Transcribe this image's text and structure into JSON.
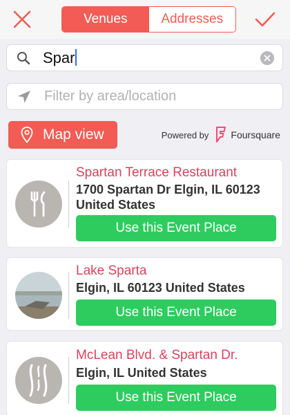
{
  "header": {
    "close_icon": "close-icon",
    "confirm_icon": "checkmark-icon",
    "tabs": [
      {
        "label": "Venues",
        "active": true
      },
      {
        "label": "Addresses",
        "active": false
      }
    ]
  },
  "search": {
    "value": "Spar",
    "icon": "search-icon",
    "clear_icon": "clear-icon"
  },
  "filter": {
    "placeholder": "Filter by area/location",
    "icon": "location-arrow-icon"
  },
  "map_view": {
    "label": "Map view",
    "icon": "map-pin-icon"
  },
  "powered_by": {
    "label": "Powered by",
    "brand": "Foursquare"
  },
  "results": [
    {
      "name": "Spartan Terrace Restaurant",
      "address": "1700 Spartan Dr Elgin, IL 60123 United States",
      "thumbnail": "fork-knife-icon",
      "action": "Use this Event Place"
    },
    {
      "name": "Lake Sparta",
      "address": "Elgin, IL 60123 United States",
      "thumbnail": "lake-photo",
      "action": "Use this Event Place"
    },
    {
      "name": "McLean Blvd. & Spartan Dr.",
      "address": "Elgin, IL United States",
      "thumbnail": "road-icon",
      "action": "Use this Event Place"
    }
  ],
  "colors": {
    "accent": "#f25c54",
    "venue_name": "#d6435c",
    "action": "#2ecc5f",
    "background": "#efeff4"
  }
}
